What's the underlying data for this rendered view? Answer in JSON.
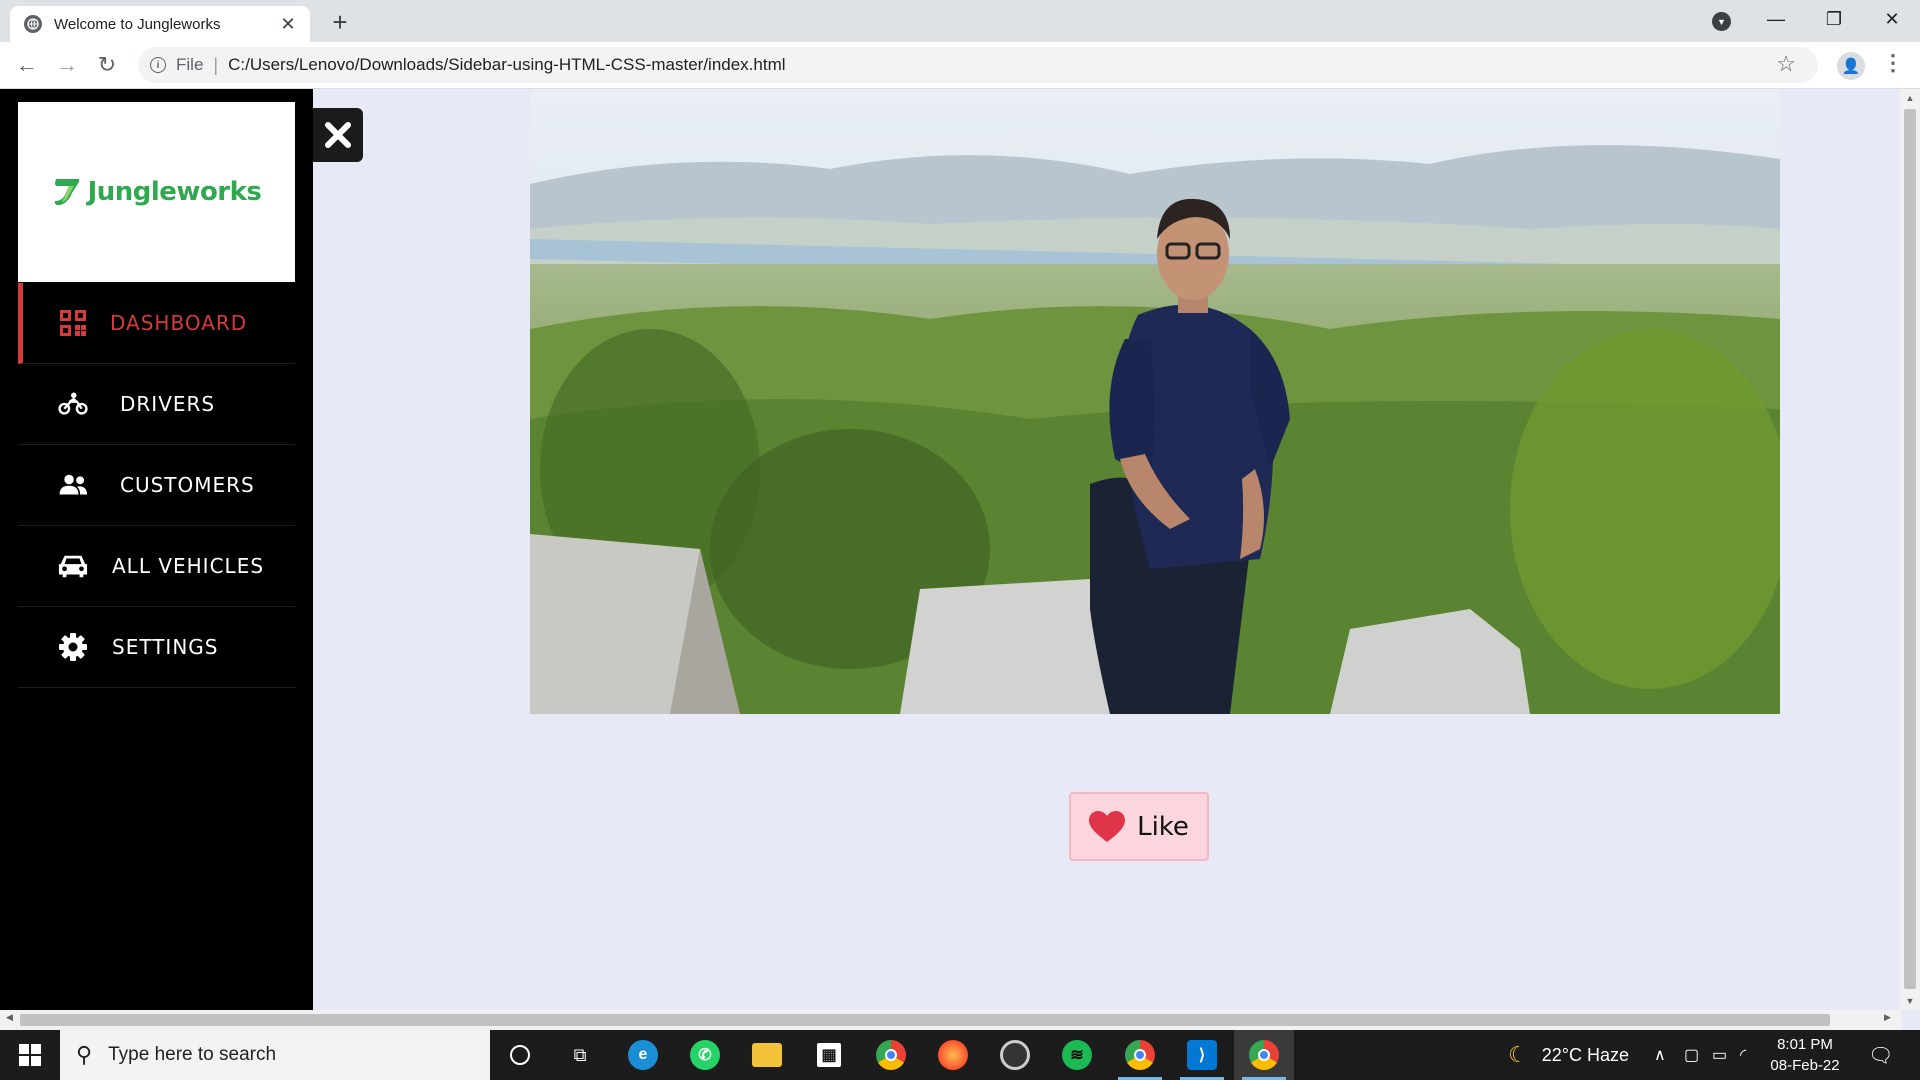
{
  "browser": {
    "tab_title": "Welcome to Jungleworks",
    "new_tab": "+",
    "file_label": "File",
    "url": "C:/Users/Lenovo/Downloads/Sidebar-using-HTML-CSS-master/index.html"
  },
  "sidebar": {
    "logo_text": "Jungleworks",
    "items": [
      {
        "label": "DASHBOARD",
        "icon": "dashboard-grid-icon",
        "active": true
      },
      {
        "label": "DRIVERS",
        "icon": "motorcycle-icon",
        "active": false
      },
      {
        "label": "CUSTOMERS",
        "icon": "users-icon",
        "active": false
      },
      {
        "label": "ALL VEHICLES",
        "icon": "car-icon",
        "active": false
      },
      {
        "label": "SETTINGS",
        "icon": "gear-icon",
        "active": false
      }
    ],
    "accent_color": "#d63a3a"
  },
  "main": {
    "like_label": "Like"
  },
  "taskbar": {
    "search_placeholder": "Type here to search",
    "weather": "22°C  Haze",
    "time": "8:01 PM",
    "date": "08-Feb-22"
  }
}
